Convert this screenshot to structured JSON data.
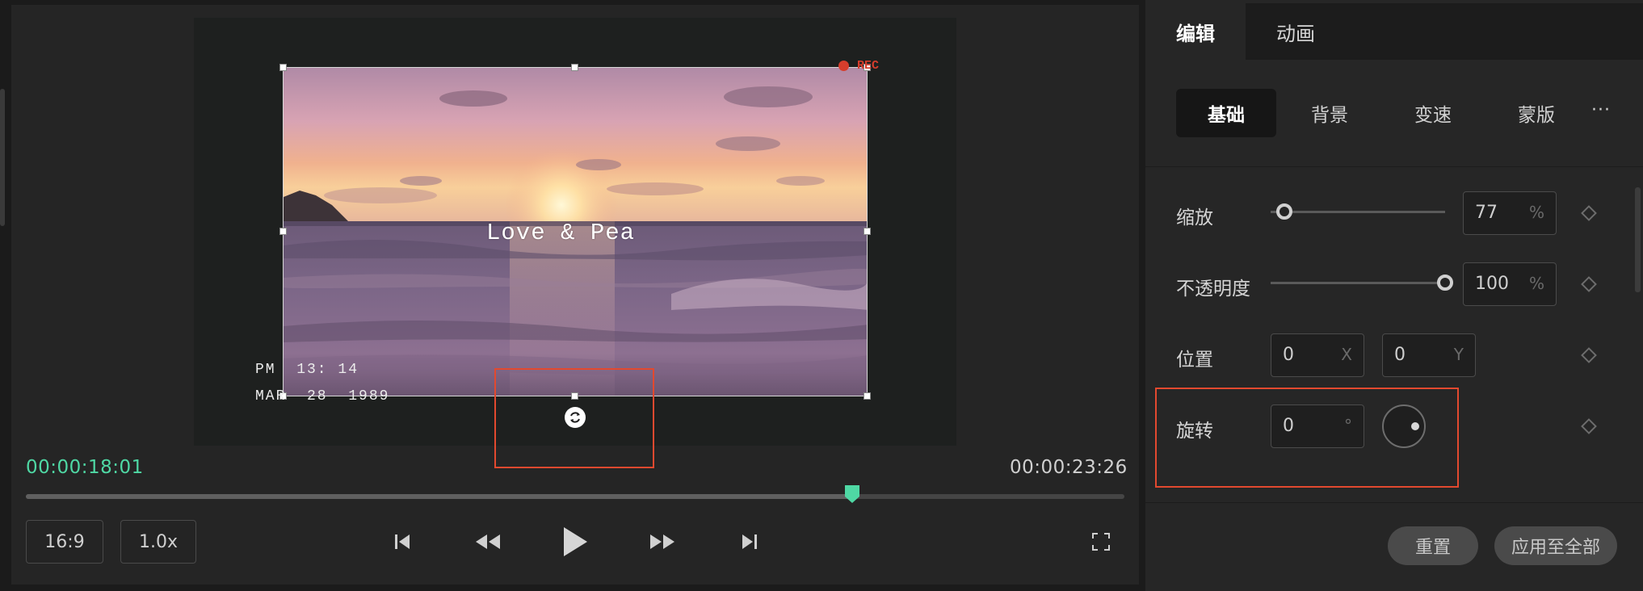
{
  "player": {
    "overlay_title": "Love & Pea",
    "rec_label": "REC",
    "stamp_time": "PM  13: 14",
    "stamp_date": "MAR  28  1989",
    "current_time": "00:00:18:01",
    "total_time": "00:00:23:26",
    "progress": 0.752,
    "accent_color": "#4fd8a4",
    "highlight_color": "#e2492f",
    "aspect_label": "16:9",
    "speed_label": "1.0x",
    "controls": {
      "skip_start": "skip-to-start-icon",
      "rewind": "rewind-icon",
      "play": "play-icon",
      "fast_forward": "fast-forward-icon",
      "skip_end": "skip-to-end-icon",
      "fullscreen": "fullscreen-icon"
    }
  },
  "panel": {
    "top_tabs": [
      {
        "label": "编辑",
        "active": true
      },
      {
        "label": "动画",
        "active": false
      }
    ],
    "sub_tabs": [
      {
        "label": "基础",
        "active": true
      },
      {
        "label": "背景",
        "active": false
      },
      {
        "label": "变速",
        "active": false
      },
      {
        "label": "蒙版",
        "active": false
      }
    ],
    "more_label": "···",
    "scale": {
      "label": "缩放",
      "value": "77",
      "unit": "%",
      "slider_fraction": 0.08
    },
    "opacity": {
      "label": "不透明度",
      "value": "100",
      "unit": "%",
      "slider_fraction": 1.0
    },
    "position": {
      "label": "位置",
      "x_value": "0",
      "x_unit": "X",
      "y_value": "0",
      "y_unit": "Y"
    },
    "rotation": {
      "label": "旋转",
      "value": "0",
      "unit": "°"
    },
    "reset_label": "重置",
    "apply_all_label": "应用至全部"
  }
}
